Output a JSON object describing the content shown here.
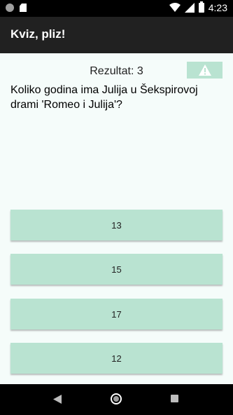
{
  "status_bar": {
    "time": "4:23"
  },
  "app_bar": {
    "title": "Kviz, pliz!"
  },
  "quiz": {
    "score_label": "Rezultat: 3",
    "question": "Koliko godina ima Julija u Šekspirovoj drami 'Romeo i Julija'?",
    "answers": [
      "13",
      "15",
      "17",
      "12"
    ]
  },
  "colors": {
    "app_bar": "#212121",
    "content_bg": "#f5fcfa",
    "answer_bg": "#b9e3d1"
  },
  "icons": {
    "status_left": [
      "circle-indicator-icon",
      "sd-card-icon"
    ],
    "status_right": [
      "wifi-icon",
      "signal-icon",
      "battery-icon"
    ],
    "report": "warning-icon",
    "nav": [
      "back-icon",
      "home-icon",
      "recents-icon"
    ]
  }
}
